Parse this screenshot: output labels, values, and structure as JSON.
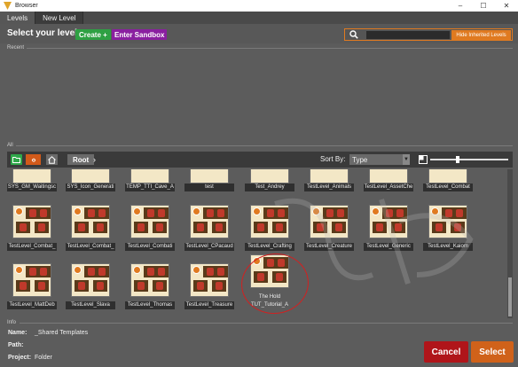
{
  "window": {
    "title": "Browser",
    "controls": [
      "–",
      "☐",
      "✕"
    ]
  },
  "tabs": [
    {
      "label": "Levels",
      "active": true
    },
    {
      "label": "New Level",
      "active": false
    }
  ],
  "header": {
    "title": "Select your level",
    "create_label": "Create +",
    "sandbox_label": "Enter Sandbox",
    "search_placeholder": "",
    "hide_inherited_label": "Hide Inherited Levels"
  },
  "sections": {
    "recent": "Recent",
    "all": "All",
    "info": "Info"
  },
  "toolbar": {
    "root_label": "Root",
    "sort_by_label": "Sort By:",
    "sort_value": "Type",
    "zoom_fraction": 0.33
  },
  "grid": {
    "row0": [
      "SYS_GM_Waitingsc",
      "SYS_Icon_Generati",
      "TEMP_TTI_Cave_A",
      "test",
      "Test_Andrey",
      "TestLevel_Animals",
      "TestLevel_AssetChe",
      "TestLevel_Combat"
    ],
    "row1": [
      "TestLevel_Combat_",
      "TestLevel_Combat_",
      "TestLevel_Combati",
      "TestLevel_CPacaud",
      "TestLevel_Crafting",
      "TestLevel_Creature",
      "TestLevel_Generic",
      "TestLevel_Kaiom"
    ],
    "row2": [
      "TestLevel_MattDeb",
      "TestLevel_Slava",
      "TestLevel_Thomas",
      "TestLevel_Treasure"
    ],
    "special": {
      "line1": "The Hold",
      "line2": "TUT_Tutorial_A"
    }
  },
  "info": {
    "name_label": "Name:",
    "name_value": "_Shared Templates",
    "path_label": "Path:",
    "path_value": "",
    "project_label": "Project:",
    "project_value": "Folder"
  },
  "actions": {
    "cancel_label": "Cancel",
    "select_label": "Select"
  },
  "colors": {
    "accent_orange": "#e07a20",
    "create_green": "#2ea043",
    "sandbox_purple": "#8a1fa0",
    "cancel_red": "#b0151a",
    "select_orange": "#d0621a",
    "annotation_red": "#d32020"
  }
}
